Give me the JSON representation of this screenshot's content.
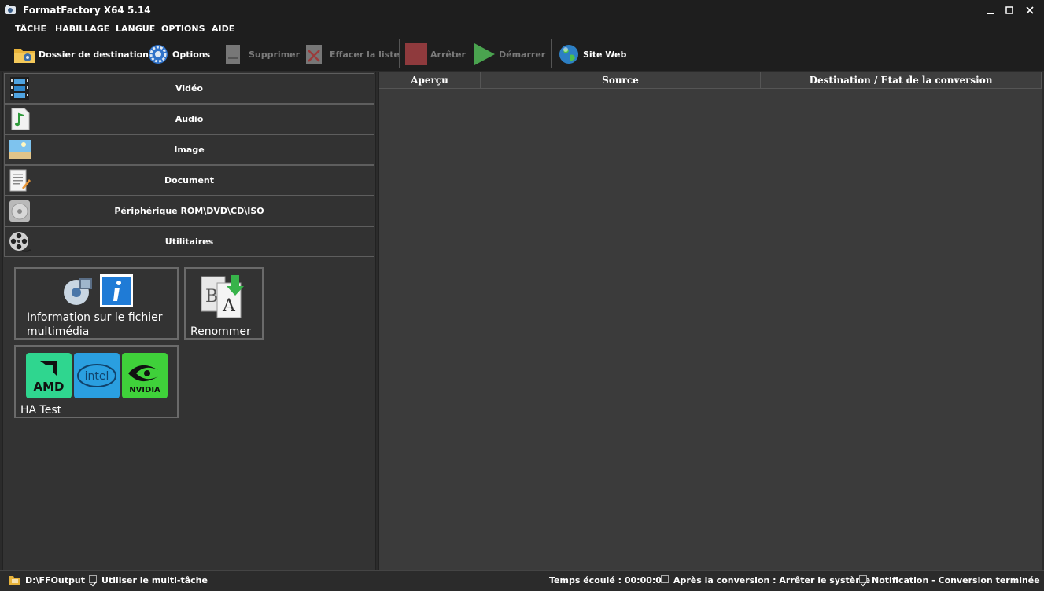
{
  "window": {
    "title": "FormatFactory X64 5.14"
  },
  "menu": [
    "TÂCHE",
    "HABILLAGE",
    "LANGUE",
    "OPTIONS",
    "AIDE"
  ],
  "toolbar": {
    "destination": "Dossier de destination",
    "options": "Options",
    "delete": "Supprimer",
    "clear": "Effacer la liste",
    "stop": "Arrêter",
    "start": "Démarrer",
    "website": "Site Web"
  },
  "categories": [
    {
      "label": "Vidéo",
      "icon": "film-icon"
    },
    {
      "label": "Audio",
      "icon": "music-note-icon"
    },
    {
      "label": "Image",
      "icon": "picture-icon"
    },
    {
      "label": "Document",
      "icon": "document-icon"
    },
    {
      "label": "Périphérique ROM\\DVD\\CD\\ISO",
      "icon": "disc-icon"
    },
    {
      "label": "Utilitaires",
      "icon": "film-reel-icon"
    }
  ],
  "tools": {
    "media_info_line1": "Information sur le fichier",
    "media_info_line2": "multimédia",
    "rename": "Renommer",
    "ha_test": "HA Test",
    "amd": "AMD",
    "intel": "intel",
    "nvidia": "NVIDIA"
  },
  "table": {
    "columns": [
      "Aperçu",
      "Source",
      "Destination / Etat de la conversion"
    ]
  },
  "status": {
    "output_folder": "D:\\FFOutput",
    "multitask": "Utiliser le multi-tâche",
    "elapsed": "Temps écoulé : 00:00:00",
    "after_conversion": "Après la conversion : Arrêter le système",
    "notification": "Notification - Conversion terminée",
    "multitask_checked": true,
    "after_conversion_checked": false,
    "notification_checked": true
  },
  "colors": {
    "background": "#2b2b2b",
    "titlebar": "#1e1e1e",
    "panel": "#333333",
    "accent_green": "#2ecc71"
  }
}
